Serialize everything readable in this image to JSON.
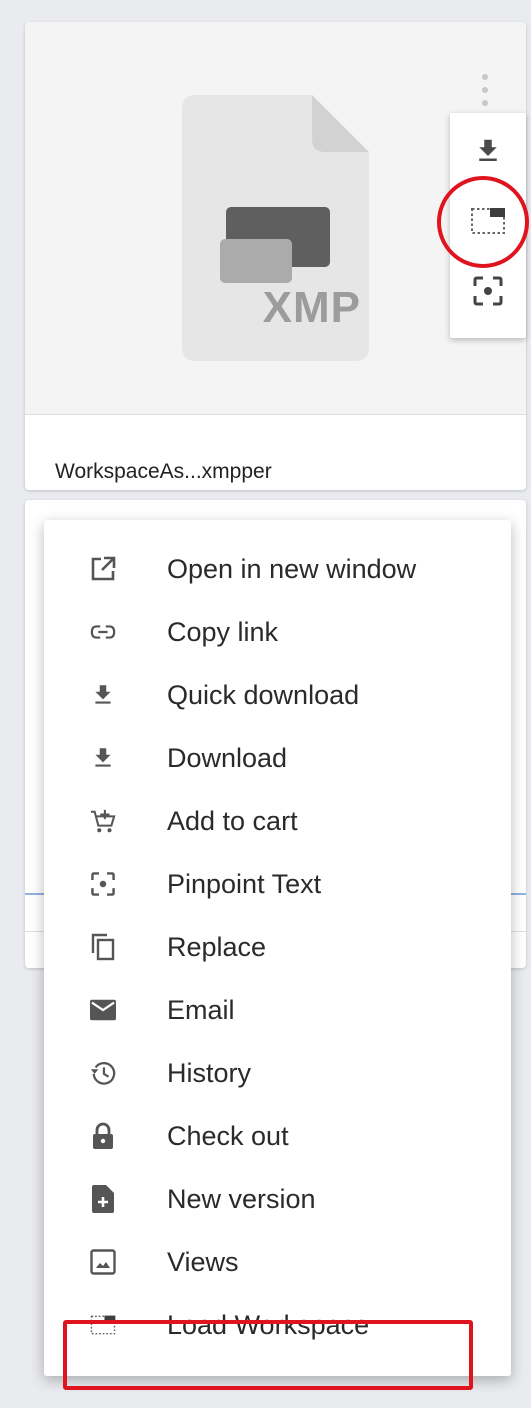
{
  "card": {
    "file_extension": "XMP",
    "filename": "WorkspaceAs...xmpper",
    "file_icon": "file-xmp-icon",
    "more_icon": "kebab-menu-icon"
  },
  "quick_actions": [
    {
      "name": "quick-download",
      "icon": "download-icon"
    },
    {
      "name": "load-workspace",
      "icon": "load-workspace-icon"
    },
    {
      "name": "pinpoint-text",
      "icon": "pinpoint-icon"
    }
  ],
  "menu": {
    "items": [
      {
        "label": "Open in new window",
        "icon": "open-external-icon"
      },
      {
        "label": "Copy link",
        "icon": "link-icon"
      },
      {
        "label": "Quick download",
        "icon": "download-icon"
      },
      {
        "label": "Download",
        "icon": "download-icon"
      },
      {
        "label": "Add to cart",
        "icon": "add-cart-icon"
      },
      {
        "label": "Pinpoint Text",
        "icon": "pinpoint-icon"
      },
      {
        "label": "Replace",
        "icon": "replace-icon"
      },
      {
        "label": "Email",
        "icon": "email-icon"
      },
      {
        "label": "History",
        "icon": "history-icon"
      },
      {
        "label": "Check out",
        "icon": "lock-icon"
      },
      {
        "label": "New version",
        "icon": "new-version-icon"
      },
      {
        "label": "Views",
        "icon": "image-icon"
      },
      {
        "label": "Load Workspace",
        "icon": "load-workspace-icon"
      }
    ]
  },
  "colors": {
    "highlight": "#e0141f",
    "icon": "#555555",
    "background": "#e9ebef"
  }
}
